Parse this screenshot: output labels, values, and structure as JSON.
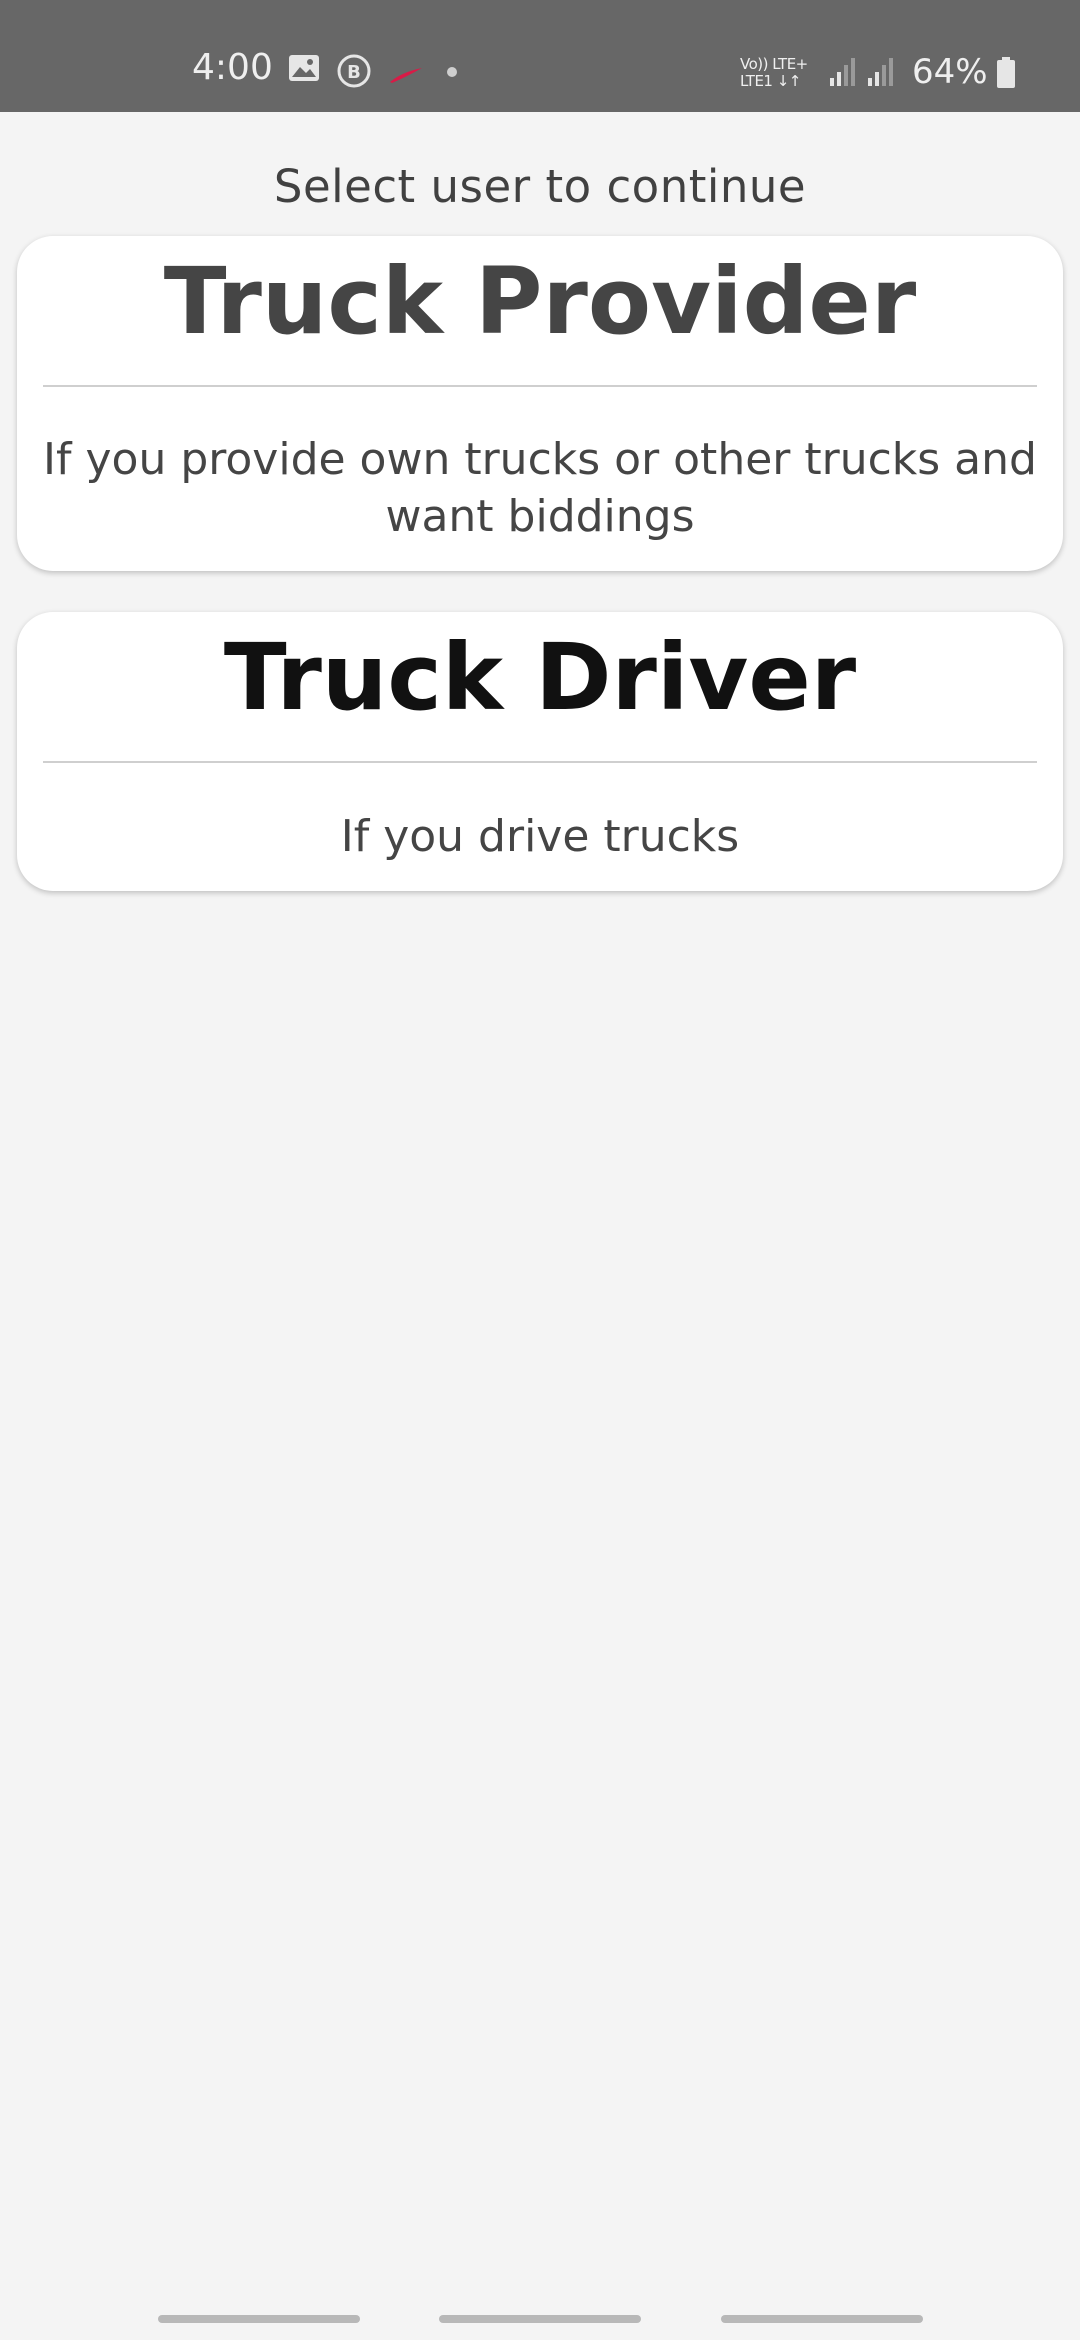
{
  "status_bar": {
    "time": "4:00",
    "network_label_top": "Vo)) LTE+",
    "network_label_bottom": "LTE1 ↓↑",
    "battery_percent": "64%",
    "icons": [
      "gallery-icon",
      "b-circle-icon",
      "app-swoosh-icon",
      "dot-icon",
      "signal-icon",
      "signal-icon",
      "battery-icon"
    ],
    "app_icon_color": "#d81b47"
  },
  "page": {
    "heading": "Select user to continue"
  },
  "cards": {
    "provider": {
      "title": "Truck Provider",
      "description": "If you provide own trucks or other trucks and want biddings"
    },
    "driver": {
      "title": "Truck Driver",
      "description": "If you drive trucks"
    }
  },
  "colors": {
    "status_bar_bg": "#676767",
    "page_bg": "#f4f4f4",
    "card_bg": "#ffffff",
    "text_primary": "#454545",
    "text_dark": "#111111"
  }
}
